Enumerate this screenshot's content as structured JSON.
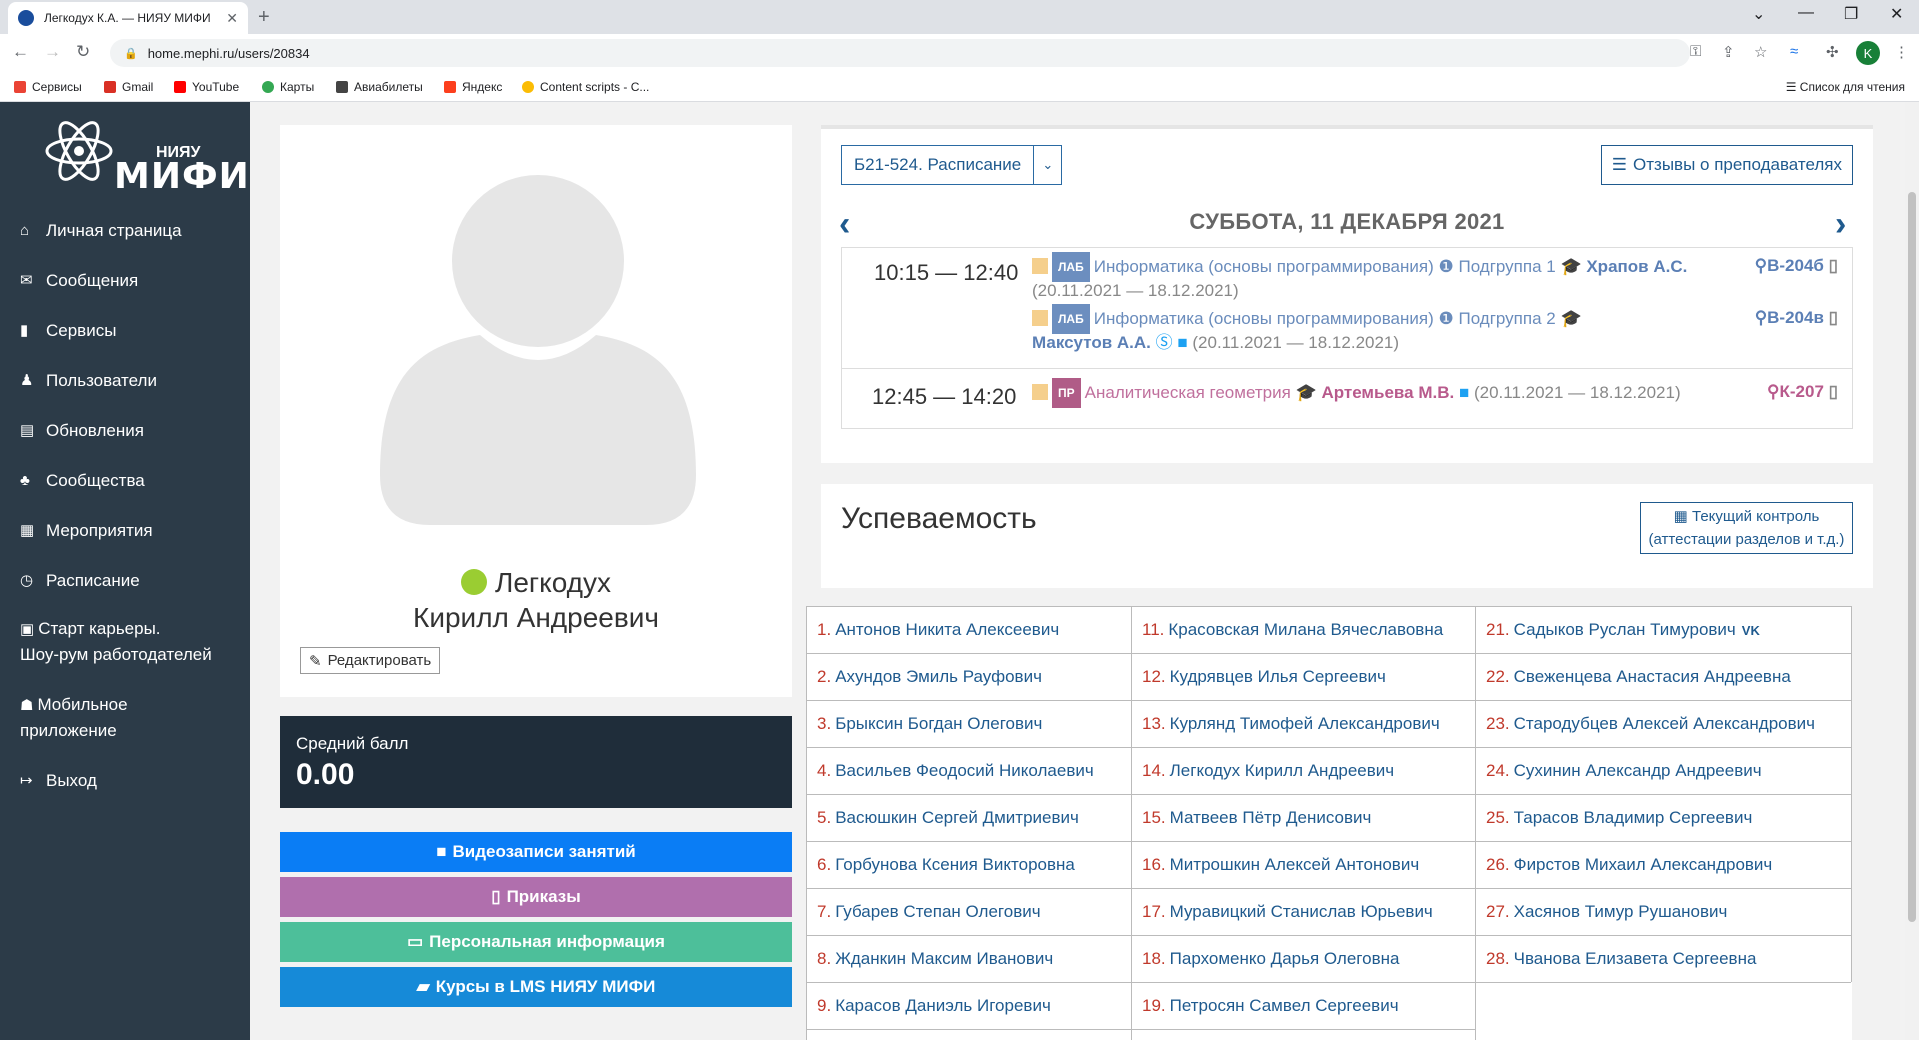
{
  "browser": {
    "tab_title": "Легкодух К.А. — НИЯУ МИФИ",
    "url": "home.mephi.ru/users/20834",
    "profile_initial": "K",
    "bookmarks": [
      "Сервисы",
      "Gmail",
      "YouTube",
      "Карты",
      "Авиабилеты",
      "Яндекс",
      "Content scripts - C..."
    ],
    "reading_list": "Список для чтения"
  },
  "sidebar": {
    "logo_small": "НИЯУ",
    "logo_big": "МИФИ",
    "items": [
      {
        "icon": "home-icon",
        "glyph": "⌂",
        "label": "Личная страница"
      },
      {
        "icon": "envelope-icon",
        "glyph": "✉",
        "label": "Сообщения"
      },
      {
        "icon": "bookmark-icon",
        "glyph": "▮",
        "label": "Сервисы"
      },
      {
        "icon": "user-icon",
        "glyph": "♟",
        "label": "Пользователи"
      },
      {
        "icon": "newspaper-icon",
        "glyph": "▤",
        "label": "Обновления"
      },
      {
        "icon": "users-icon",
        "glyph": "♣",
        "label": "Сообщества"
      },
      {
        "icon": "calendar-icon",
        "glyph": "▦",
        "label": "Мероприятия"
      },
      {
        "icon": "clock-icon",
        "glyph": "◷",
        "label": "Расписание"
      },
      {
        "icon": "briefcase-icon",
        "glyph": "▣",
        "label": "Старт карьеры.",
        "label2": "Шоу-рум работодателей"
      },
      {
        "icon": "android-icon",
        "glyph": "☗",
        "label": "Мобильное",
        "label2": "приложение"
      },
      {
        "icon": "sign-out-icon",
        "glyph": "↦",
        "label": "Выход"
      }
    ]
  },
  "profile": {
    "last_name": "Легкодух",
    "first_names": "Кирилл Андреевич",
    "edit_label": "Редактировать",
    "avg_label": "Средний балл",
    "avg_value": "0.00"
  },
  "actions": {
    "video": "Видеозаписи занятий",
    "orders": "Приказы",
    "personal": "Персональная информация",
    "lms": "Курсы в LMS НИЯУ МИФИ"
  },
  "colors": {
    "sidebar": "#2c3b48",
    "video": "#0a7df5",
    "orders": "#b06fad",
    "personal": "#4dbf9a",
    "lms": "#168ad8",
    "lab_badge": "#6c8ebf",
    "pr_badge": "#b05c87"
  },
  "schedule": {
    "group": "Б21-524. Расписание",
    "reviews": "Отзывы о преподавателях",
    "date": "СУББОТА, 11 ДЕКАБРЯ 2021",
    "slot1_time": "10:15 — 12:40",
    "slot2_time": "12:45 — 14:20",
    "l1": {
      "type": "ЛАБ",
      "subject": "Информатика (основы программирования)",
      "subgroup": "Подгруппа 1",
      "teacher": "Храпов А.С.",
      "room": "В-204б",
      "period": "(20.11.2021 — 18.12.2021)"
    },
    "l2": {
      "type": "ЛАБ",
      "subject": "Информатика (основы программирования)",
      "subgroup": "Подгруппа 2",
      "teacher": "Максутов А.А.",
      "room": "В-204в",
      "period": "(20.11.2021 — 18.12.2021)"
    },
    "l3": {
      "type": "ПР",
      "subject": "Аналитическая геометрия",
      "teacher": "Артемьева М.В.",
      "room": "К-207",
      "period": "(20.11.2021 — 18.12.2021)"
    }
  },
  "performance": {
    "title": "Успеваемость",
    "control_line1": "Текущий контроль",
    "control_line2": "(аттестации разделов и т.д.)"
  },
  "students": {
    "col1": [
      {
        "n": "1.",
        "name": "Антонов Никита Алексеевич"
      },
      {
        "n": "2.",
        "name": "Ахундов Эмиль Рауфович"
      },
      {
        "n": "3.",
        "name": "Брыксин Богдан Олегович"
      },
      {
        "n": "4.",
        "name": "Васильев Феодосий Николаевич"
      },
      {
        "n": "5.",
        "name": "Васюшкин Сергей Дмитриевич"
      },
      {
        "n": "6.",
        "name": "Горбунова Ксения Викторовна"
      },
      {
        "n": "7.",
        "name": "Губарев Степан Олегович"
      },
      {
        "n": "8.",
        "name": "Жданкин Максим Иванович"
      },
      {
        "n": "9.",
        "name": "Карасов Даниэль Игоревич"
      }
    ],
    "col2": [
      {
        "n": "11.",
        "name": "Красовская Милана Вячеславовна"
      },
      {
        "n": "12.",
        "name": "Кудрявцев Илья Сергеевич"
      },
      {
        "n": "13.",
        "name": "Курлянд Тимофей Александрович"
      },
      {
        "n": "14.",
        "name": "Легкодух Кирилл Андреевич"
      },
      {
        "n": "15.",
        "name": "Матвеев Пётр Денисович"
      },
      {
        "n": "16.",
        "name": "Митрошкин Алексей Антонович"
      },
      {
        "n": "17.",
        "name": "Муравицкий Станислав Юрьевич"
      },
      {
        "n": "18.",
        "name": "Пархоменко Дарья Олеговна"
      },
      {
        "n": "19.",
        "name": "Петросян Самвел Сергеевич"
      }
    ],
    "col3": [
      {
        "n": "21.",
        "name": "Садыков Руслан Тимурович",
        "extra": "VK"
      },
      {
        "n": "22.",
        "name": "Свеженцева Анастасия Андреевна"
      },
      {
        "n": "23.",
        "name": "Стародубцев Алексей Александрович"
      },
      {
        "n": "24.",
        "name": "Сухинин Александр Андреевич"
      },
      {
        "n": "25.",
        "name": "Тарасов Владимир Сергеевич"
      },
      {
        "n": "26.",
        "name": "Фирстов Михаил Александрович"
      },
      {
        "n": "27.",
        "name": "Хасянов Тимур Рушанович"
      },
      {
        "n": "28.",
        "name": "Чванова Елизавета Сергеевна"
      }
    ]
  }
}
